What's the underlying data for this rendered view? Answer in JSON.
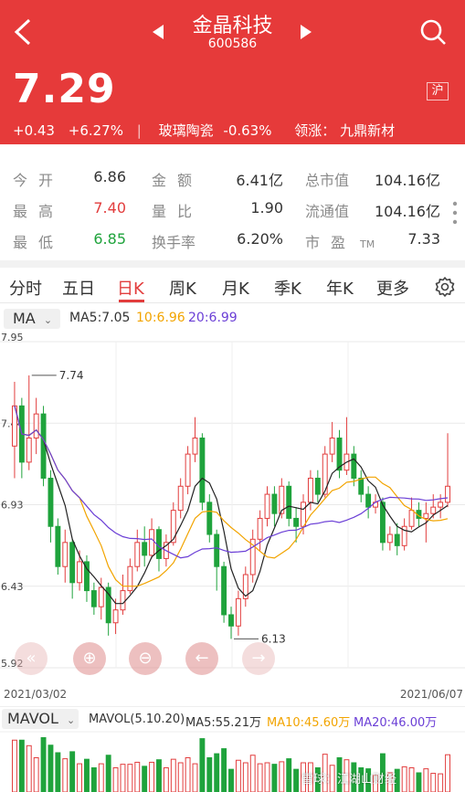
{
  "header": {
    "title": "金晶科技",
    "code": "600586",
    "price": "7.29",
    "market_badge": "沪",
    "change": "+0.43",
    "change_pct": "+6.27%",
    "sector_name": "玻璃陶瓷",
    "sector_change": "-0.63%",
    "leader_label": "领涨：",
    "leader_name": "九鼎新材",
    "bg_color": "#e63a3a"
  },
  "stats": [
    {
      "label": "今开",
      "value": "6.86",
      "tone": "normal"
    },
    {
      "label": "金额",
      "value": "6.41亿",
      "tone": "normal"
    },
    {
      "label": "总市值",
      "value": "104.16亿",
      "tone": "normal"
    },
    {
      "label": "最高",
      "value": "7.40",
      "tone": "red"
    },
    {
      "label": "量比",
      "value": "1.90",
      "tone": "normal"
    },
    {
      "label": "流通值",
      "value": "104.16亿",
      "tone": "normal"
    },
    {
      "label": "最低",
      "value": "6.85",
      "tone": "green"
    },
    {
      "label": "换手率",
      "value": "6.20%",
      "tone": "normal"
    },
    {
      "label": "市盈",
      "label_suffix": "TM",
      "value": "7.33",
      "tone": "normal"
    }
  ],
  "tabs": [
    {
      "label": "分时",
      "active": false
    },
    {
      "label": "五日",
      "active": false
    },
    {
      "label": "日K",
      "active": true
    },
    {
      "label": "周K",
      "active": false
    },
    {
      "label": "月K",
      "active": false
    },
    {
      "label": "季K",
      "active": false
    },
    {
      "label": "年K",
      "active": false
    },
    {
      "label": "更多",
      "active": false
    }
  ],
  "ma_bar": {
    "select": "MA",
    "ma5": "MA5:7.05",
    "ma10": "10:6.96",
    "ma20": "20:6.99",
    "colors": {
      "ma5": "#222222",
      "ma10": "#f2a400",
      "ma20": "#6b3fd6"
    }
  },
  "price_chart": {
    "y_ticks": [
      "7.95",
      "7.44",
      "6.93",
      "6.43",
      "5.92"
    ],
    "high_marker": "7.74",
    "low_marker": "6.13",
    "start_date": "2021/03/02",
    "end_date": "2021/06/07",
    "up_color": "#e23d3d",
    "down_color": "#1fa33c"
  },
  "chart_controls": [
    {
      "name": "fast-back",
      "glyph": "«"
    },
    {
      "name": "zoom-in",
      "glyph": "⊕"
    },
    {
      "name": "zoom-out",
      "glyph": "⊖"
    },
    {
      "name": "left",
      "glyph": "←"
    },
    {
      "name": "right",
      "glyph": "→"
    }
  ],
  "volume_bar": {
    "select": "MAVOL",
    "params": "MAVOL(5.10.20)",
    "ma5": "MA5:55.21万",
    "ma10": "MA10:45.60万",
    "ma20": "MA20:46.00万"
  },
  "watermark": "雪球：江湖山财经",
  "chart_data": {
    "type": "candlestick",
    "ylim": [
      5.92,
      7.95
    ],
    "x_range": [
      "2021/03/02",
      "2021/06/07"
    ],
    "candles": [
      [
        7.3,
        7.55,
        7.7,
        7.1
      ],
      [
        7.55,
        7.2,
        7.6,
        7.1
      ],
      [
        7.2,
        7.35,
        7.74,
        7.15
      ],
      [
        7.35,
        7.5,
        7.6,
        7.25
      ],
      [
        7.5,
        7.1,
        7.55,
        7.05
      ],
      [
        7.1,
        6.8,
        7.15,
        6.7
      ],
      [
        6.8,
        6.55,
        6.85,
        6.5
      ],
      [
        6.55,
        6.7,
        6.78,
        6.45
      ],
      [
        6.7,
        6.45,
        6.72,
        6.35
      ],
      [
        6.45,
        6.58,
        6.65,
        6.4
      ],
      [
        6.58,
        6.4,
        6.62,
        6.33
      ],
      [
        6.4,
        6.3,
        6.45,
        6.25
      ],
      [
        6.3,
        6.42,
        6.48,
        6.22
      ],
      [
        6.42,
        6.2,
        6.45,
        6.12
      ],
      [
        6.2,
        6.28,
        6.35,
        6.13
      ],
      [
        6.28,
        6.4,
        6.5,
        6.25
      ],
      [
        6.4,
        6.55,
        6.6,
        6.38
      ],
      [
        6.55,
        6.7,
        6.78,
        6.52
      ],
      [
        6.7,
        6.62,
        6.8,
        6.55
      ],
      [
        6.62,
        6.78,
        6.85,
        6.6
      ],
      [
        6.78,
        6.6,
        6.8,
        6.52
      ],
      [
        6.6,
        6.7,
        6.75,
        6.55
      ],
      [
        6.7,
        6.9,
        6.95,
        6.68
      ],
      [
        6.9,
        7.05,
        7.1,
        6.85
      ],
      [
        7.05,
        7.25,
        7.3,
        7.0
      ],
      [
        7.25,
        7.35,
        7.48,
        7.2
      ],
      [
        7.35,
        6.95,
        7.38,
        6.9
      ],
      [
        6.95,
        6.75,
        7.0,
        6.7
      ],
      [
        6.75,
        6.55,
        6.78,
        6.4
      ],
      [
        6.55,
        6.25,
        6.58,
        6.2
      ],
      [
        6.25,
        6.18,
        6.3,
        6.1
      ],
      [
        6.18,
        6.35,
        6.4,
        6.12
      ],
      [
        6.35,
        6.5,
        6.55,
        6.3
      ],
      [
        6.5,
        6.72,
        6.78,
        6.45
      ],
      [
        6.72,
        6.85,
        6.9,
        6.65
      ],
      [
        6.85,
        7.0,
        7.05,
        6.8
      ],
      [
        7.0,
        6.88,
        7.05,
        6.8
      ],
      [
        6.88,
        7.05,
        7.1,
        6.85
      ],
      [
        7.05,
        6.85,
        7.08,
        6.8
      ],
      [
        6.85,
        6.8,
        6.92,
        6.7
      ],
      [
        6.8,
        6.95,
        7.0,
        6.75
      ],
      [
        6.95,
        7.1,
        7.15,
        6.9
      ],
      [
        7.1,
        7.0,
        7.15,
        6.95
      ],
      [
        7.0,
        7.25,
        7.3,
        6.98
      ],
      [
        7.25,
        7.35,
        7.45,
        7.2
      ],
      [
        7.35,
        7.15,
        7.4,
        7.1
      ],
      [
        7.15,
        7.25,
        7.48,
        7.12
      ],
      [
        7.25,
        7.1,
        7.3,
        7.05
      ],
      [
        7.1,
        7.0,
        7.15,
        6.95
      ],
      [
        7.0,
        6.92,
        7.05,
        6.85
      ],
      [
        6.92,
        6.95,
        7.0,
        6.88
      ],
      [
        6.95,
        6.7,
        6.98,
        6.65
      ],
      [
        6.7,
        6.75,
        6.8,
        6.65
      ],
      [
        6.75,
        6.68,
        6.82,
        6.62
      ],
      [
        6.68,
        6.8,
        6.85,
        6.65
      ],
      [
        6.8,
        6.9,
        6.98,
        6.78
      ],
      [
        6.9,
        6.85,
        6.95,
        6.8
      ],
      [
        6.85,
        6.88,
        6.95,
        6.7
      ],
      [
        6.88,
        6.92,
        7.0,
        6.85
      ],
      [
        6.92,
        6.95,
        7.0,
        6.85
      ],
      [
        6.95,
        7.05,
        7.38,
        6.92
      ]
    ]
  }
}
